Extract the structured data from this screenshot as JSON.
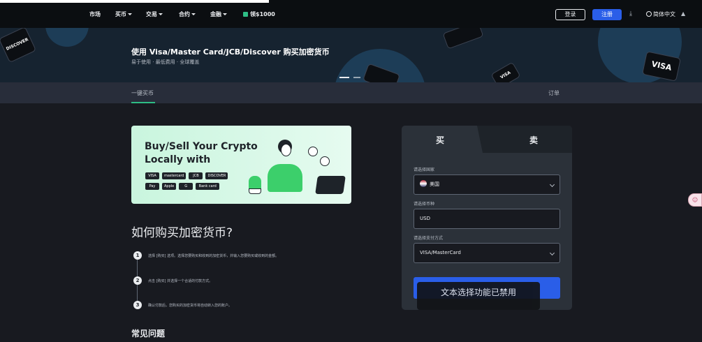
{
  "nav": {
    "items": [
      {
        "label": "市场",
        "has_caret": false
      },
      {
        "label": "买币",
        "has_caret": true
      },
      {
        "label": "交易",
        "has_caret": true
      },
      {
        "label": "合约",
        "has_caret": true
      },
      {
        "label": "金融",
        "has_caret": true
      }
    ],
    "promo_label": "领$1000",
    "login_label": "登录",
    "register_label": "注册",
    "language_label": "简体中文"
  },
  "hero": {
    "title": "使用 Visa/Master Card/JCB/Discover 购买加密货币",
    "subtitle": "易于使用 · 最低费用 · 全球覆盖",
    "card_labels": [
      "DISCOVER",
      "VISA",
      "VISA"
    ]
  },
  "tabs": {
    "one_click": "一键买币",
    "orders": "订单"
  },
  "banner": {
    "title": "Buy/Sell Your Crypto Locally with",
    "payment_row1": [
      "VISA",
      "mastercard",
      "JCB",
      "DISCOVER"
    ],
    "payment_row2": [
      "Pay",
      "Apple",
      "G",
      "Bank card"
    ]
  },
  "how_to": {
    "title": "如何购买加密货币?",
    "steps": [
      {
        "num": "1",
        "text": "选择 [购买] 选项。选择您要购买和收到的加密货币，并输入您要购买或收到的金额。"
      },
      {
        "num": "2",
        "text": "点击 [购买] 并选择一个合适的付款方式。"
      },
      {
        "num": "3",
        "text": "确认付款后，您购买的加密货币将自动转入您的账户。"
      }
    ]
  },
  "faq": {
    "title": "常见问题"
  },
  "trade_panel": {
    "buy_tab": "买",
    "sell_tab": "卖",
    "country_label": "请选择国家",
    "country_value": "美国",
    "currency_label": "请选择币种",
    "currency_value": "USD",
    "payment_label": "请选择支付方式",
    "payment_value": "VISA/MasterCard"
  },
  "toast": {
    "text": "文本选择功能已禁用"
  },
  "colors": {
    "accent_blue": "#2a5ee8",
    "accent_green": "#2ebd85",
    "page_bg": "#181a20",
    "panel_bg": "#2b3139"
  }
}
